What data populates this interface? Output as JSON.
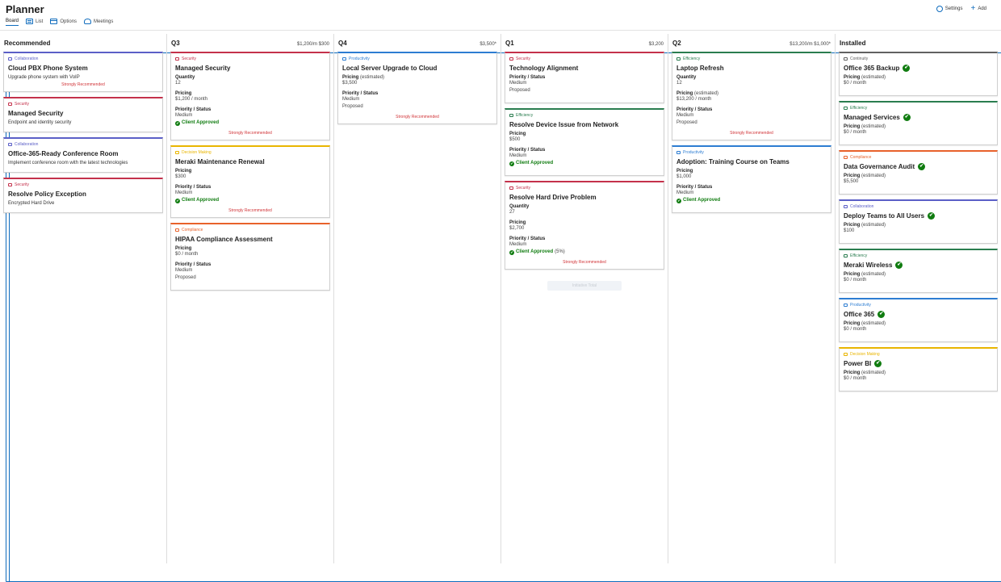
{
  "app": {
    "title": "Planner"
  },
  "tabs": [
    {
      "label": "Board",
      "icon": "board-icon"
    },
    {
      "label": "List",
      "icon": "list-icon"
    },
    {
      "label": "Options",
      "icon": "calendar-icon"
    },
    {
      "label": "Meetings",
      "icon": "meeting-icon"
    }
  ],
  "actions": {
    "settings": "Settings",
    "add": "Add"
  },
  "colors": {
    "Collaboration": "#5b5fc7",
    "Security": "#c4314b",
    "Decision Making": "#e9b500",
    "Compliance": "#e8622b",
    "Productivity": "#2d7dd2",
    "Efficiency": "#2a7d4f",
    "Continuity": "#616161"
  },
  "columns": {
    "recommended": {
      "title": "Recommended",
      "summary": "",
      "cards": [
        {
          "category": "Collaboration",
          "title": "Cloud PBX Phone System",
          "desc": "Upgrade phone system with VoIP",
          "strong": "Strongly Recommended"
        },
        {
          "category": "Security",
          "title": "Managed Security",
          "desc": "Endpoint and identity security"
        },
        {
          "category": "Collaboration",
          "title": "Office-365-Ready Conference Room",
          "desc": "Implement conference room with the latest technologies"
        },
        {
          "category": "Security",
          "title": "Resolve Policy Exception",
          "desc": "Encrypted Hard Drive"
        }
      ]
    },
    "q3": {
      "title": "Q3",
      "summary": "$1,200/m $300",
      "cards": [
        {
          "category": "Security",
          "title": "Managed Security",
          "qty_label": "Quantity",
          "qty": "12",
          "pricing_label": "Pricing",
          "pricing": "$1,200 / month",
          "ps_label": "Priority / Status",
          "priority": "Medium",
          "approved": "Client Approved",
          "strong": "Strongly Recommended"
        },
        {
          "category": "Decision Making",
          "title": "Meraki Maintenance Renewal",
          "pricing_label": "Pricing",
          "pricing": "$300",
          "ps_label": "Priority / Status",
          "priority": "Medium",
          "approved": "Client Approved",
          "strong": "Strongly Recommended"
        },
        {
          "category": "Compliance",
          "title": "HIPAA Compliance Assessment",
          "pricing_label": "Pricing",
          "pricing": "$0 / month",
          "ps_label": "Priority / Status",
          "priority": "Medium",
          "status": "Proposed"
        }
      ]
    },
    "q4": {
      "title": "Q4",
      "summary": "$3,500*",
      "cards": [
        {
          "category": "Productivity",
          "title": "Local Server Upgrade to Cloud",
          "pricing_label": "Pricing",
          "est": "(estimated)",
          "pricing": "$3,500",
          "ps_label": "Priority / Status",
          "priority": "Medium",
          "status": "Proposed",
          "strong": "Strongly Recommended"
        }
      ]
    },
    "q1": {
      "title": "Q1",
      "summary": "$3,200",
      "cards": [
        {
          "category": "Security",
          "title": "Technology Alignment",
          "ps_label": "Priority / Status",
          "priority": "Medium",
          "status": "Proposed"
        },
        {
          "category": "Efficiency",
          "title": "Resolve Device Issue from Network",
          "pricing_label": "Pricing",
          "pricing": "$500",
          "ps_label": "Priority / Status",
          "priority": "Medium",
          "approved": "Client Approved"
        },
        {
          "category": "Security",
          "title": "Resolve Hard Drive Problem",
          "qty_label": "Quantity",
          "qty": "27",
          "pricing_label": "Pricing",
          "pricing": "$2,700",
          "ps_label": "Priority / Status",
          "priority": "Medium",
          "approved": "Client Approved",
          "approved_pct": "(5%)",
          "strong": "Strongly Recommended"
        }
      ],
      "placeholder": "Initiative Total"
    },
    "q2": {
      "title": "Q2",
      "summary": "$13,200/m $1,000*",
      "cards": [
        {
          "category": "Efficiency",
          "title": "Laptop Refresh",
          "qty_label": "Quantity",
          "qty": "12",
          "pricing_label": "Pricing",
          "est": "(estimated)",
          "pricing": "$13,200 / month",
          "ps_label": "Priority / Status",
          "priority": "Medium",
          "status": "Proposed",
          "strong": "Strongly Recommended"
        },
        {
          "category": "Productivity",
          "title": "Adoption: Training Course on Teams",
          "pricing_label": "Pricing",
          "pricing": "$1,000",
          "ps_label": "Priority / Status",
          "priority": "Medium",
          "approved": "Client Approved"
        }
      ]
    },
    "installed": {
      "title": "Installed",
      "summary": "",
      "cards": [
        {
          "category": "Continuity",
          "title": "Office 365 Backup",
          "check": true,
          "pricing_label": "Pricing",
          "est": "(estimated)",
          "pricing": "$0 / month"
        },
        {
          "category": "Efficiency",
          "title": "Managed Services",
          "check": true,
          "pricing_label": "Pricing",
          "est": "(estimated)",
          "pricing": "$0 / month"
        },
        {
          "category": "Compliance",
          "title": "Data Governance Audit",
          "check": true,
          "pricing_label": "Pricing",
          "est": "(estimated)",
          "pricing": "$5,500"
        },
        {
          "category": "Collaboration",
          "title": "Deploy Teams to All Users",
          "check": true,
          "pricing_label": "Pricing",
          "est": "(estimated)",
          "pricing": "$100"
        },
        {
          "category": "Efficiency",
          "title": "Meraki Wireless",
          "check": true,
          "pricing_label": "Pricing",
          "est": "(estimated)",
          "pricing": "$0 / month"
        },
        {
          "category": "Productivity",
          "title": "Office 365",
          "check": true,
          "pricing_label": "Pricing",
          "est": "(estimated)",
          "pricing": "$0 / month"
        },
        {
          "category": "Decision Making",
          "title": "Power BI",
          "check": true,
          "pricing_label": "Pricing",
          "est": "(estimated)",
          "pricing": "$0 / month"
        }
      ]
    }
  }
}
